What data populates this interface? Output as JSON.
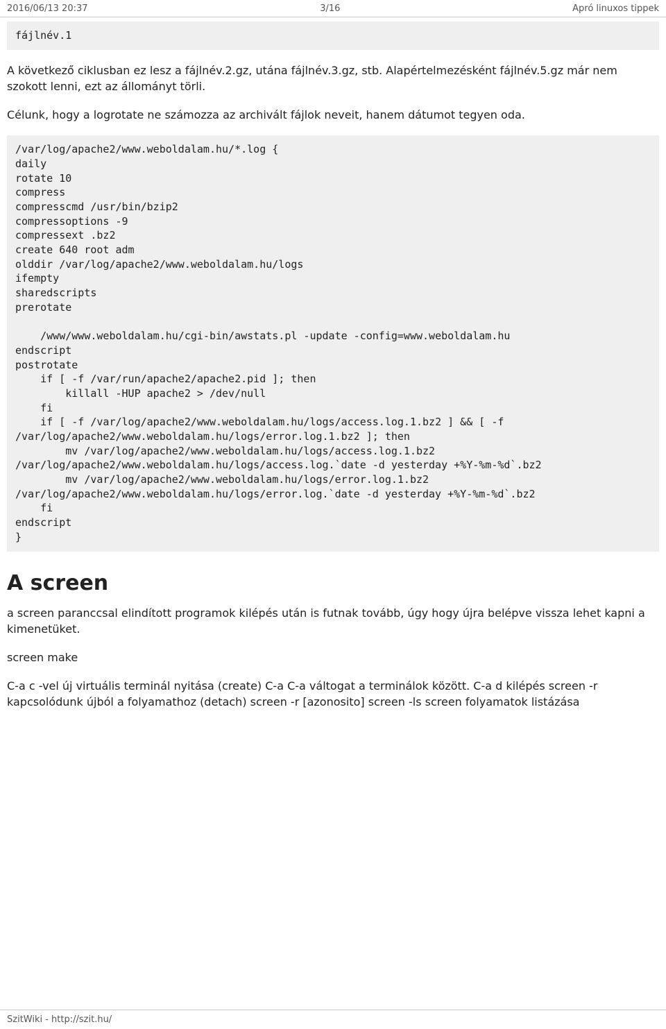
{
  "header": {
    "left": "2016/06/13 20:37",
    "center": "3/16",
    "right": "Apró linuxos tippek"
  },
  "code1": "fájlnév.1",
  "para1": "A következő ciklusban ez lesz a fájlnév.2.gz, utána fájlnév.3.gz, stb. Alapértelmezésként fájlnév.5.gz már nem szokott lenni, ezt az állományt törli.",
  "para2": "Célunk, hogy a logrotate ne számozza az archivált fájlok neveit, hanem dátumot tegyen oda.",
  "code2": "/var/log/apache2/www.weboldalam.hu/*.log {\ndaily\nrotate 10\ncompress\ncompresscmd /usr/bin/bzip2\ncompressoptions -9\ncompressext .bz2\ncreate 640 root adm\nolddir /var/log/apache2/www.weboldalam.hu/logs\nifempty\nsharedscripts\nprerotate\n\n    /www/www.weboldalam.hu/cgi-bin/awstats.pl -update -config=www.weboldalam.hu\nendscript\npostrotate\n    if [ -f /var/run/apache2/apache2.pid ]; then\n        killall -HUP apache2 > /dev/null\n    fi\n    if [ -f /var/log/apache2/www.weboldalam.hu/logs/access.log.1.bz2 ] && [ -f /var/log/apache2/www.weboldalam.hu/logs/error.log.1.bz2 ]; then\n        mv /var/log/apache2/www.weboldalam.hu/logs/access.log.1.bz2 /var/log/apache2/www.weboldalam.hu/logs/access.log.`date -d yesterday +%Y-%m-%d`.bz2\n        mv /var/log/apache2/www.weboldalam.hu/logs/error.log.1.bz2 /var/log/apache2/www.weboldalam.hu/logs/error.log.`date -d yesterday +%Y-%m-%d`.bz2\n    fi\nendscript\n}",
  "section_title": "A screen",
  "para3": "a screen paranccsal elindított programok kilépés után is futnak tovább, úgy hogy újra belépve vissza lehet kapni a kimenetüket.",
  "para4": "screen make",
  "para5": "C-a c -vel új virtuális terminál nyitása (create) C-a C-a váltogat a terminálok között. C-a d kilépés screen -r kapcsolódunk újból a folyamathoz (detach) screen -r [azonosito] screen -ls screen folyamatok listázása",
  "footer": "SzitWiki - http://szit.hu/"
}
